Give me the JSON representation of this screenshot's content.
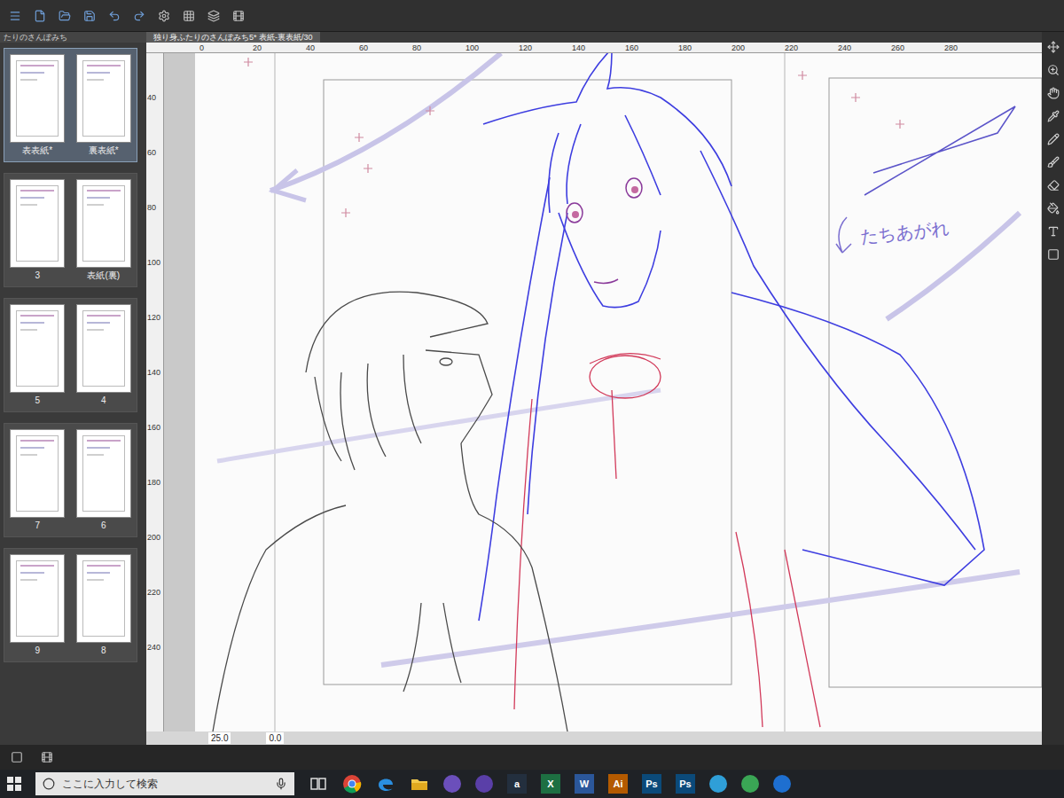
{
  "tabs": [
    {
      "label": "たりのさんぽみち",
      "selected": false
    },
    {
      "label": "独り身ふたりのさんぽみち5* 表紙-裏表紙/30",
      "selected": true
    }
  ],
  "page_panel": {
    "spreads": [
      {
        "selected": true,
        "pages": [
          {
            "label": "表表紙*"
          },
          {
            "label": "裏表紙*"
          }
        ]
      },
      {
        "selected": false,
        "pages": [
          {
            "label": "3"
          },
          {
            "label": "表紙(裏)"
          }
        ]
      },
      {
        "selected": false,
        "pages": [
          {
            "label": "5"
          },
          {
            "label": "4"
          }
        ]
      },
      {
        "selected": false,
        "pages": [
          {
            "label": "7"
          },
          {
            "label": "6"
          }
        ]
      },
      {
        "selected": false,
        "pages": [
          {
            "label": "9"
          },
          {
            "label": "8"
          }
        ]
      }
    ]
  },
  "rulers": {
    "top": [
      "0",
      "20",
      "40",
      "60",
      "80",
      "100",
      "120",
      "140",
      "160",
      "180",
      "200",
      "220",
      "240",
      "260",
      "280"
    ],
    "left": [
      "40",
      "60",
      "80",
      "100",
      "120",
      "140",
      "160",
      "180",
      "200",
      "220",
      "240"
    ]
  },
  "canvas": {
    "note": "たちあがれ"
  },
  "status_bar": {
    "zoom": "25.0",
    "rotation": "0.0"
  },
  "taskbar": {
    "search_placeholder": "ここに入力して検索",
    "apps": [
      {
        "kind": "taskview"
      },
      {
        "kind": "chrome"
      },
      {
        "kind": "edge"
      },
      {
        "kind": "folder"
      },
      {
        "kind": "dot",
        "color": "#6b4fbb"
      },
      {
        "kind": "dot",
        "color": "#5a3fa8"
      },
      {
        "kind": "letter",
        "label": "a",
        "color": "#232f3e"
      },
      {
        "kind": "letter",
        "label": "X",
        "color": "#1d6f42"
      },
      {
        "kind": "letter",
        "label": "W",
        "color": "#2b579a"
      },
      {
        "kind": "letter",
        "label": "Ai",
        "color": "#b35a00"
      },
      {
        "kind": "letter",
        "label": "Ps",
        "color": "#0b4a7a"
      },
      {
        "kind": "letter",
        "label": "Ps",
        "color": "#0b4a7a"
      },
      {
        "kind": "dot",
        "color": "#2f9fd8"
      },
      {
        "kind": "dot",
        "color": "#3aa655"
      },
      {
        "kind": "dot",
        "color": "#1e6fd0"
      }
    ]
  }
}
